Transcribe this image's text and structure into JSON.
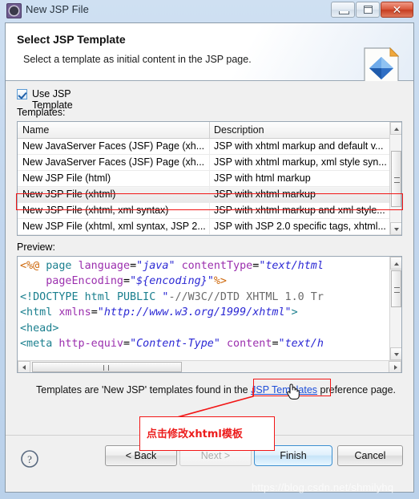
{
  "window": {
    "title": "New JSP File",
    "icon": "jsp-gear-icon",
    "controls": {
      "minimize": "–",
      "maximize": "□",
      "close": "✕"
    }
  },
  "banner": {
    "title": "Select JSP Template",
    "subtitle": "Select a template as initial content in the JSP page.",
    "icon": "jsp-page-diamond-icon"
  },
  "options": {
    "use_template_label": "Use JSP Template",
    "use_template_checked": true,
    "templates_label": "Templates:"
  },
  "table": {
    "columns": [
      "Name",
      "Description"
    ],
    "rows": [
      {
        "name": "New JavaServer Faces (JSF) Page (xh...",
        "description": "JSP with xhtml markup and default v...",
        "selected": false
      },
      {
        "name": "New JavaServer Faces (JSF) Page (xh...",
        "description": "JSP with xhtml markup, xml style syn...",
        "selected": false
      },
      {
        "name": "New JSP File (html)",
        "description": "JSP with html markup",
        "selected": false
      },
      {
        "name": "New JSP File (xhtml)",
        "description": "JSP with xhtml markup",
        "selected": true
      },
      {
        "name": "New JSP File (xhtml, xml syntax)",
        "description": "JSP with xhtml markup and xml style...",
        "selected": false
      },
      {
        "name": "New JSP File (xhtml, xml syntax, JSP 2...",
        "description": "JSP with JSP 2.0 specific tags, xhtml...",
        "selected": false
      }
    ]
  },
  "preview": {
    "label": "Preview:",
    "lines": [
      "<%@ page language=\"java\" contentType=\"text/html",
      "    pageEncoding=\"${encoding}\"%>",
      "<!DOCTYPE html PUBLIC \"-//W3C//DTD XHTML 1.0 Tr",
      "<html xmlns=\"http://www.w3.org/1999/xhtml\">",
      "<head>",
      "<meta http-equiv=\"Content-Type\" content=\"text/h"
    ]
  },
  "footnote": {
    "before": "Templates are 'New JSP' templates found in the ",
    "link": "JSP Templates",
    "after": " preference page."
  },
  "buttons": {
    "back": "< Back",
    "next": "Next >",
    "finish": "Finish",
    "cancel": "Cancel",
    "help": "help-icon"
  },
  "annotation": {
    "text": "点击修改xhtml模板",
    "color": "#ec1c1c"
  },
  "watermark": "https://blog.csdn.net/shmilyhq",
  "colors": {
    "accent": "#1f4fd8",
    "annotation_red": "#f21616",
    "finish_blue": "#3c8fd0"
  }
}
